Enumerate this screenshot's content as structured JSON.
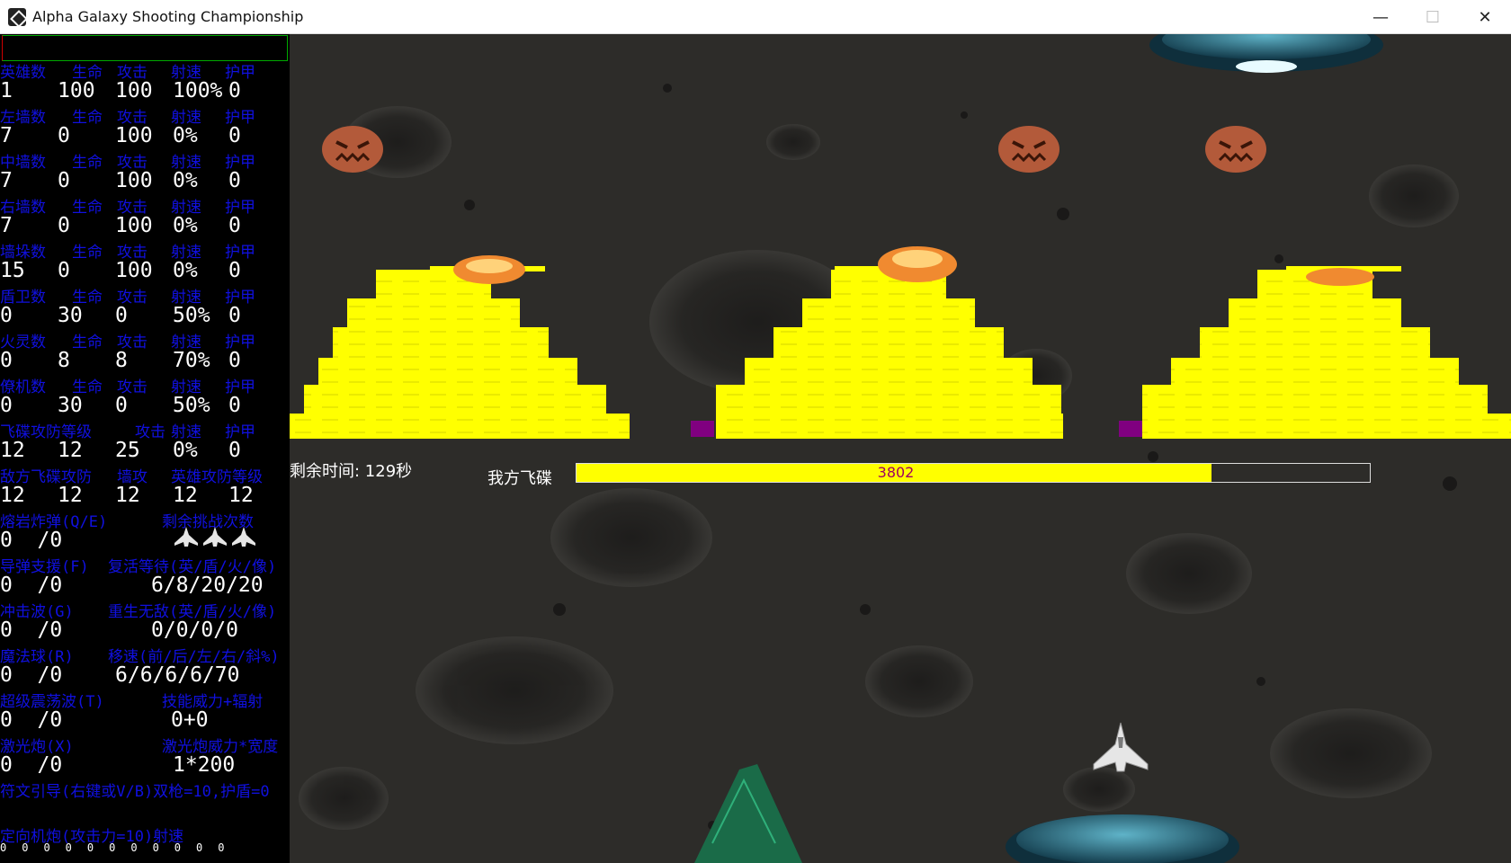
{
  "window": {
    "title": "Alpha Galaxy Shooting Championship",
    "min_glyph": "—",
    "max_glyph": "☐",
    "close_glyph": "✕"
  },
  "stats": {
    "rows": [
      {
        "header": [
          "英雄数",
          "生命",
          "攻击",
          "射速",
          "护甲"
        ],
        "values": [
          "1",
          "100",
          "100",
          "100%",
          "0"
        ]
      },
      {
        "header": [
          "左墙数",
          "生命",
          "攻击",
          "射速",
          "护甲"
        ],
        "values": [
          "7",
          "0",
          "100",
          "0%",
          "0"
        ]
      },
      {
        "header": [
          "中墙数",
          "生命",
          "攻击",
          "射速",
          "护甲"
        ],
        "values": [
          "7",
          "0",
          "100",
          "0%",
          "0"
        ]
      },
      {
        "header": [
          "右墙数",
          "生命",
          "攻击",
          "射速",
          "护甲"
        ],
        "values": [
          "7",
          "0",
          "100",
          "0%",
          "0"
        ]
      },
      {
        "header": [
          "墙垛数",
          "生命",
          "攻击",
          "射速",
          "护甲"
        ],
        "values": [
          "15",
          "0",
          "100",
          "0%",
          "0"
        ]
      },
      {
        "header": [
          "盾卫数",
          "生命",
          "攻击",
          "射速",
          "护甲"
        ],
        "values": [
          "0",
          "30",
          "0",
          "50%",
          "0"
        ]
      },
      {
        "header": [
          "火灵数",
          "生命",
          "攻击",
          "射速",
          "护甲"
        ],
        "values": [
          "0",
          "8",
          "8",
          "70%",
          "0"
        ]
      },
      {
        "header": [
          "僚机数",
          "生命",
          "攻击",
          "射速",
          "护甲"
        ],
        "values": [
          "0",
          "30",
          "0",
          "50%",
          "0"
        ]
      },
      {
        "header": [
          "飞碟攻防等级",
          "攻击",
          "射速",
          "护甲"
        ],
        "values": [
          "12",
          "12",
          "25",
          "0%",
          "0"
        ]
      },
      {
        "header": [
          "敌方飞碟攻防",
          "墙攻",
          "英雄攻防等级"
        ],
        "values": [
          "12",
          "12",
          "12",
          "12",
          "12"
        ]
      }
    ],
    "skills": [
      {
        "left_label": "熔岩炸弹(Q/E)",
        "right_label": "剩余挑战次数",
        "left_value": "0  /0",
        "right_value": "",
        "lives": 3
      },
      {
        "left_label": "导弹支援(F)",
        "right_label": "复活等待(英/盾/火/像)",
        "left_value": "0  /0",
        "right_value": "6/8/20/20"
      },
      {
        "left_label": "冲击波(G)",
        "right_label": "重生无敌(英/盾/火/像)",
        "left_value": "0  /0",
        "right_value": "0/0/0/0"
      },
      {
        "left_label": "魔法球(R)",
        "right_label": "移速(前/后/左/右/斜%)",
        "left_value": "0  /0",
        "right_value": "6/6/6/6/70"
      },
      {
        "left_label": "超级震荡波(T)",
        "right_label": "技能威力+辐射",
        "left_value": "0  /0",
        "right_value": "0+0"
      },
      {
        "left_label": "激光炮(X)",
        "right_label": "激光炮威力*宽度",
        "left_value": "0  /0",
        "right_value": "1*200"
      }
    ],
    "rune_line": "符文引导(右键或V/B)双枪=10,护盾=0",
    "turret_line": "定向机炮(攻击力=10)射速",
    "dots": "00000000000"
  },
  "hud": {
    "time_left": "剩余时间: 129秒",
    "our_ufo_label": "我方飞碟",
    "ufo_hp": "3802",
    "ufo_hp_fraction": 0.8
  },
  "colors": {
    "wall_yellow": "#ffff00",
    "gate_purple": "#800080",
    "header_blue": "#1010e0",
    "hp_text": "#a00060"
  }
}
